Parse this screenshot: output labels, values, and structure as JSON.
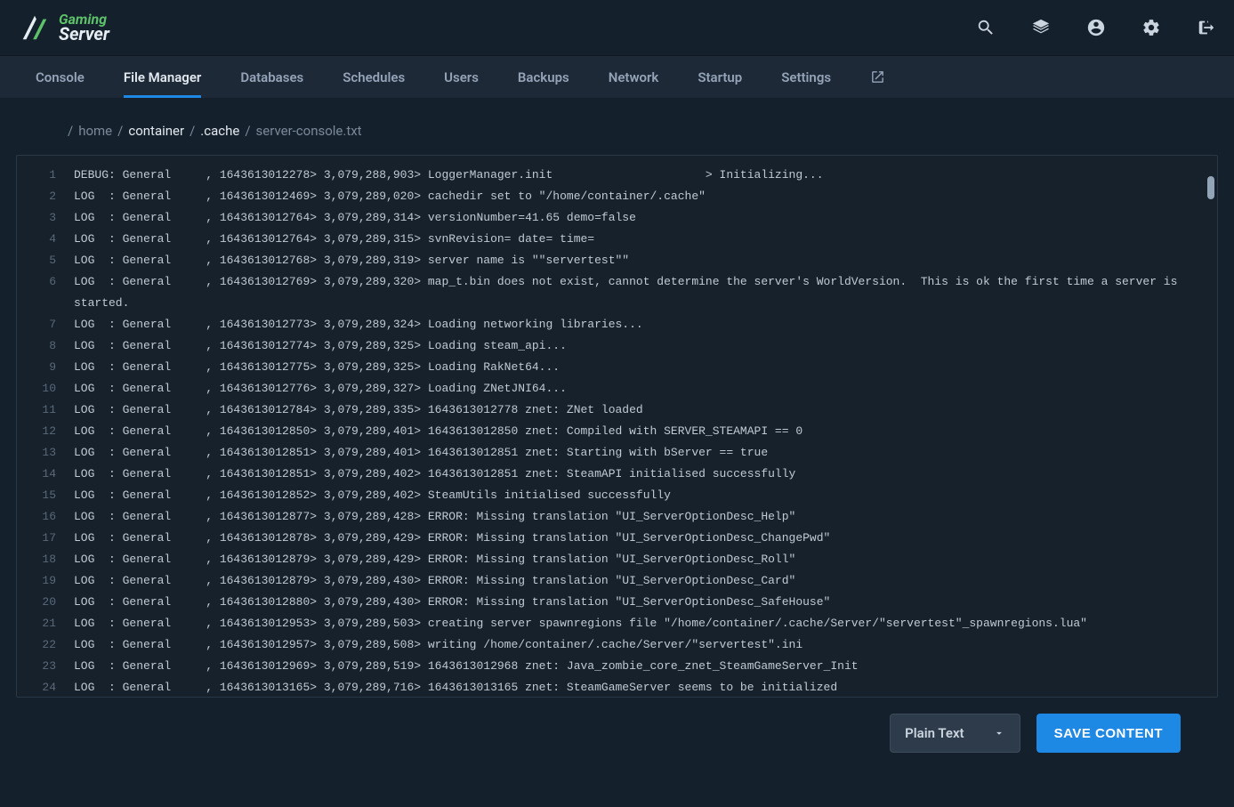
{
  "logo": {
    "line1": "Gaming",
    "line2": "Server"
  },
  "nav": {
    "items": [
      {
        "label": "Console"
      },
      {
        "label": "File Manager",
        "active": true
      },
      {
        "label": "Databases"
      },
      {
        "label": "Schedules"
      },
      {
        "label": "Users"
      },
      {
        "label": "Backups"
      },
      {
        "label": "Network"
      },
      {
        "label": "Startup"
      },
      {
        "label": "Settings"
      }
    ]
  },
  "breadcrumb": {
    "segments": [
      {
        "text": "home",
        "strong": false
      },
      {
        "text": "container",
        "strong": true
      },
      {
        "text": ".cache",
        "strong": true
      },
      {
        "text": "server-console.txt",
        "strong": false
      }
    ]
  },
  "editor": {
    "lines": [
      "DEBUG: General     , 1643613012278> 3,079,288,903> LoggerManager.init                      > Initializing...",
      "LOG  : General     , 1643613012469> 3,079,289,020> cachedir set to \"/home/container/.cache\"",
      "LOG  : General     , 1643613012764> 3,079,289,314> versionNumber=41.65 demo=false",
      "LOG  : General     , 1643613012764> 3,079,289,315> svnRevision= date= time=",
      "LOG  : General     , 1643613012768> 3,079,289,319> server name is \"\"servertest\"\"",
      "LOG  : General     , 1643613012769> 3,079,289,320> map_t.bin does not exist, cannot determine the server's WorldVersion.  This is ok the first time a server is started.",
      "LOG  : General     , 1643613012773> 3,079,289,324> Loading networking libraries...",
      "LOG  : General     , 1643613012774> 3,079,289,325> Loading steam_api...",
      "LOG  : General     , 1643613012775> 3,079,289,325> Loading RakNet64...",
      "LOG  : General     , 1643613012776> 3,079,289,327> Loading ZNetJNI64...",
      "LOG  : General     , 1643613012784> 3,079,289,335> 1643613012778 znet: ZNet loaded",
      "LOG  : General     , 1643613012850> 3,079,289,401> 1643613012850 znet: Compiled with SERVER_STEAMAPI == 0",
      "LOG  : General     , 1643613012851> 3,079,289,401> 1643613012851 znet: Starting with bServer == true",
      "LOG  : General     , 1643613012851> 3,079,289,402> 1643613012851 znet: SteamAPI initialised successfully",
      "LOG  : General     , 1643613012852> 3,079,289,402> SteamUtils initialised successfully",
      "LOG  : General     , 1643613012877> 3,079,289,428> ERROR: Missing translation \"UI_ServerOptionDesc_Help\"",
      "LOG  : General     , 1643613012878> 3,079,289,429> ERROR: Missing translation \"UI_ServerOptionDesc_ChangePwd\"",
      "LOG  : General     , 1643613012879> 3,079,289,429> ERROR: Missing translation \"UI_ServerOptionDesc_Roll\"",
      "LOG  : General     , 1643613012879> 3,079,289,430> ERROR: Missing translation \"UI_ServerOptionDesc_Card\"",
      "LOG  : General     , 1643613012880> 3,079,289,430> ERROR: Missing translation \"UI_ServerOptionDesc_SafeHouse\"",
      "LOG  : General     , 1643613012953> 3,079,289,503> creating server spawnregions file \"/home/container/.cache/Server/\"servertest\"_spawnregions.lua\"",
      "LOG  : General     , 1643613012957> 3,079,289,508> writing /home/container/.cache/Server/\"servertest\".ini",
      "LOG  : General     , 1643613012969> 3,079,289,519> 1643613012968 znet: Java_zombie_core_znet_SteamGameServer_Init",
      "LOG  : General     , 1643613013165> 3,079,289,716> 1643613013165 znet: SteamGameServer seems to be initialized"
    ]
  },
  "footer": {
    "select_label": "Plain Text",
    "save_label": "SAVE CONTENT"
  }
}
